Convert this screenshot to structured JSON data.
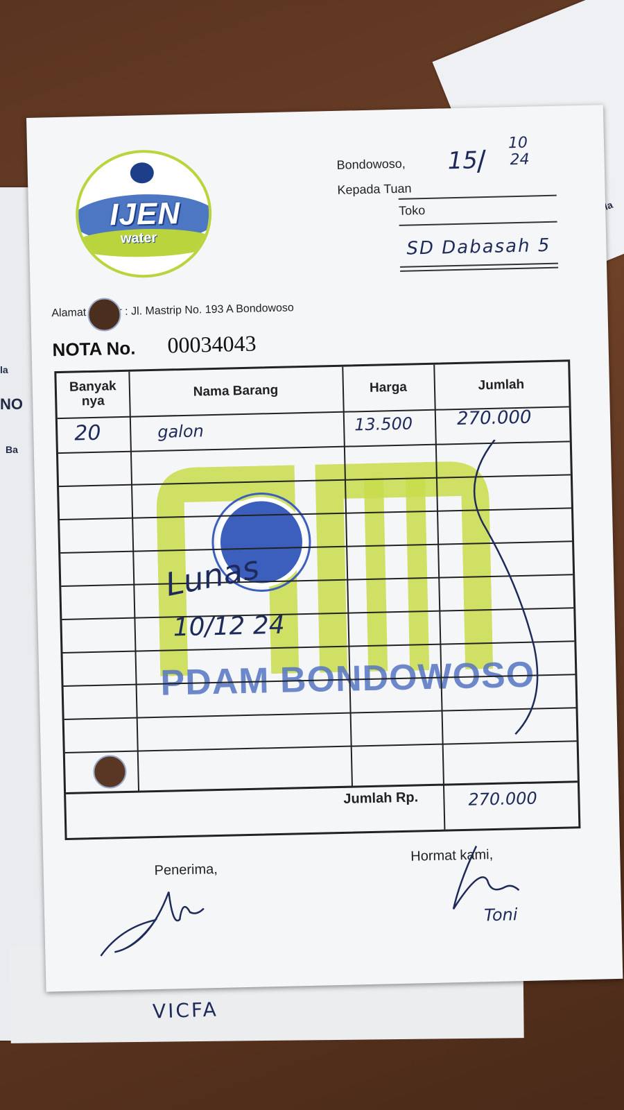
{
  "header": {
    "logo_brand": "IJEN",
    "logo_sub": "water",
    "city_label": "Bondowoso,",
    "date_handwritten_day": "15",
    "date_handwritten_month": "10",
    "date_handwritten_year": "24",
    "kepada_label": "Kepada Tuan",
    "toko_label": "Toko",
    "recipient_handwritten": "SD Dabasah 5",
    "address": "Alamat Kantor : Jl. Mastrip No. 193 A Bondowoso"
  },
  "nota": {
    "label": "NOTA No.",
    "number": "00034043"
  },
  "table": {
    "headers": [
      "Banyak nya",
      "Nama Barang",
      "Harga",
      "Jumlah"
    ],
    "rows": [
      {
        "qty": "20",
        "item": "galon",
        "price": "13.500",
        "amount": "270.000"
      }
    ],
    "total_label": "Jumlah Rp.",
    "total_value": "270.000",
    "watermark": "PDAM BONDOWOSO",
    "stamp_handwritten": "Lunas",
    "stamp_date": "10/12 24"
  },
  "footer": {
    "receiver_label": "Penerima,",
    "sender_label": "Hormat kami,",
    "sender_name_handwritten": "Toni",
    "below_receipt_handwritten": "VICFA"
  },
  "background_fragments": {
    "left_a": "la",
    "left_b": "NO",
    "left_c": "Ba",
    "right_a": "Ala"
  },
  "colors": {
    "brand_blue": "#2f5fb8",
    "brand_green": "#b9d43c",
    "ink": "#1e2a5a"
  }
}
